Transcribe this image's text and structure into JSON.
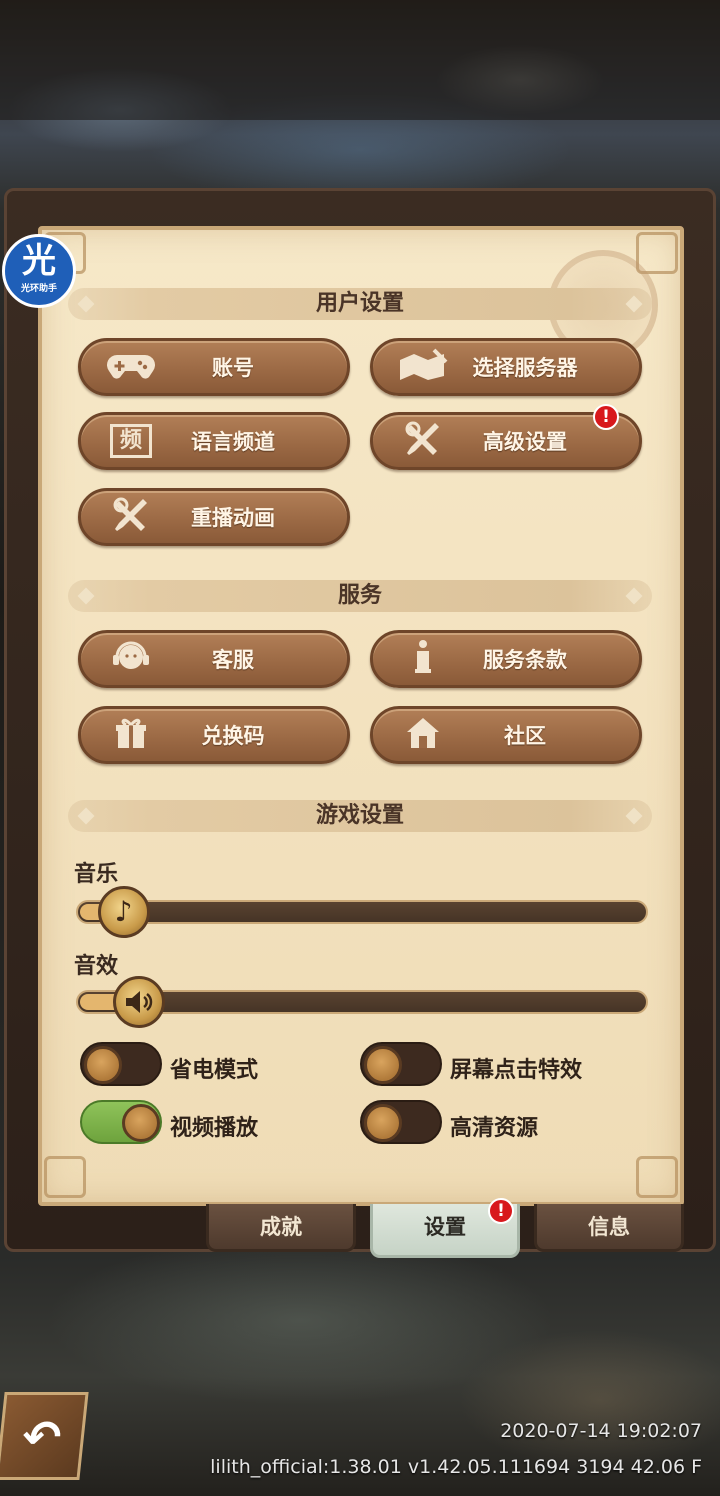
{
  "logo": {
    "main": "光",
    "sub": "光环助手"
  },
  "sections": {
    "user": "用户设置",
    "service": "服务",
    "game": "游戏设置"
  },
  "user_buttons": [
    {
      "label": "账号",
      "icon": "gamepad-icon"
    },
    {
      "label": "选择服务器",
      "icon": "map-icon"
    },
    {
      "label": "语言频道",
      "icon": "channel-icon",
      "icon_char": "频"
    },
    {
      "label": "高级设置",
      "icon": "tools-icon"
    },
    {
      "label": "重播动画",
      "icon": "tools-icon"
    }
  ],
  "service_buttons": [
    {
      "label": "客服",
      "icon": "support-icon"
    },
    {
      "label": "服务条款",
      "icon": "info-icon"
    },
    {
      "label": "兑换码",
      "icon": "gift-icon"
    },
    {
      "label": "社区",
      "icon": "home-icon"
    }
  ],
  "badge_text": "!",
  "sliders": {
    "music": {
      "label": "音乐",
      "value": 0.05
    },
    "sfx": {
      "label": "音效",
      "value": 0.08
    }
  },
  "toggles": {
    "power_saving": {
      "label": "省电模式",
      "on": false
    },
    "tap_effect": {
      "label": "屏幕点击特效",
      "on": false
    },
    "video_playback": {
      "label": "视频播放",
      "on": true
    },
    "hd_resources": {
      "label": "高清资源",
      "on": false
    }
  },
  "tabs": [
    "成就",
    "设置",
    "信息"
  ],
  "active_tab": "设置",
  "footer": {
    "datetime": "2020-07-14 19:02:07",
    "version": "lilith_official:1.38.01  v1.42.05.111694 3194 42.06 F"
  },
  "colors": {
    "parchment": "#f3e2bf",
    "button_brown": "#9c6a45",
    "badge_red": "#d8181c",
    "toggle_on": "#8fc35a"
  }
}
